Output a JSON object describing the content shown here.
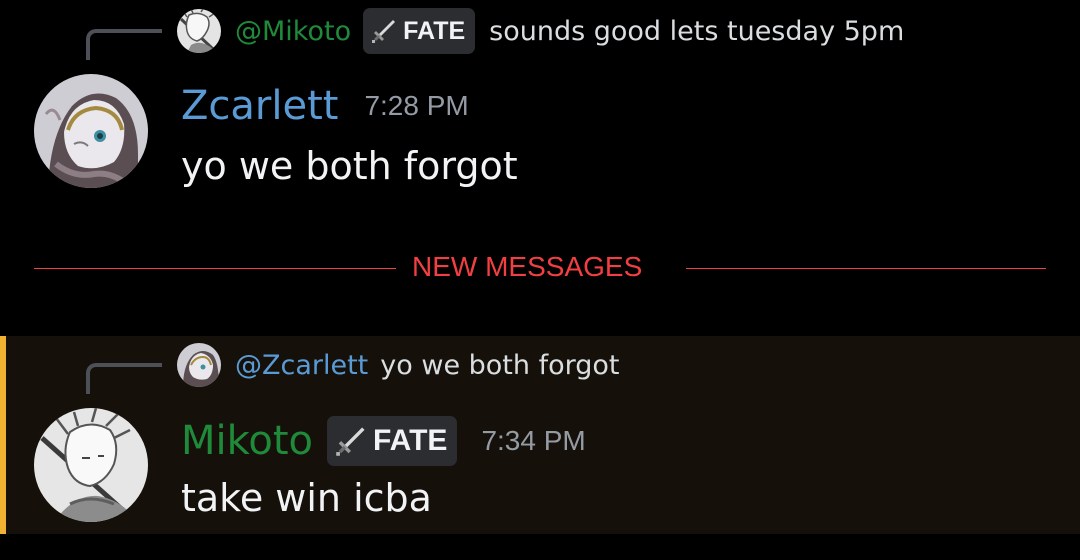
{
  "colors": {
    "background": "#000000",
    "mention_highlight": "#15110a",
    "mention_bar": "#f0b232",
    "zcarlett_name": "#5b9bd5",
    "mikoto_name": "#1f8b3a",
    "new_messages": "#f23f43",
    "tag_background": "#2b2d31",
    "timestamp": "#949ba4",
    "message_text": "#f2f3f5"
  },
  "messages": [
    {
      "reply": {
        "mention": "@Mikoto",
        "tag_icon": "sword-icon",
        "tag": "FATE",
        "text": "sounds good lets tuesday 5pm"
      },
      "author": "Zcarlett",
      "timestamp": "7:28 PM",
      "content": "yo we both forgot"
    },
    {
      "reply": {
        "mention": "@Zcarlett",
        "text": "yo we both forgot"
      },
      "author": "Mikoto",
      "tag_icon": "sword-icon",
      "tag": "FATE",
      "timestamp": "7:34 PM",
      "content": "take win icba"
    }
  ],
  "divider": {
    "label": "NEW MESSAGES"
  }
}
